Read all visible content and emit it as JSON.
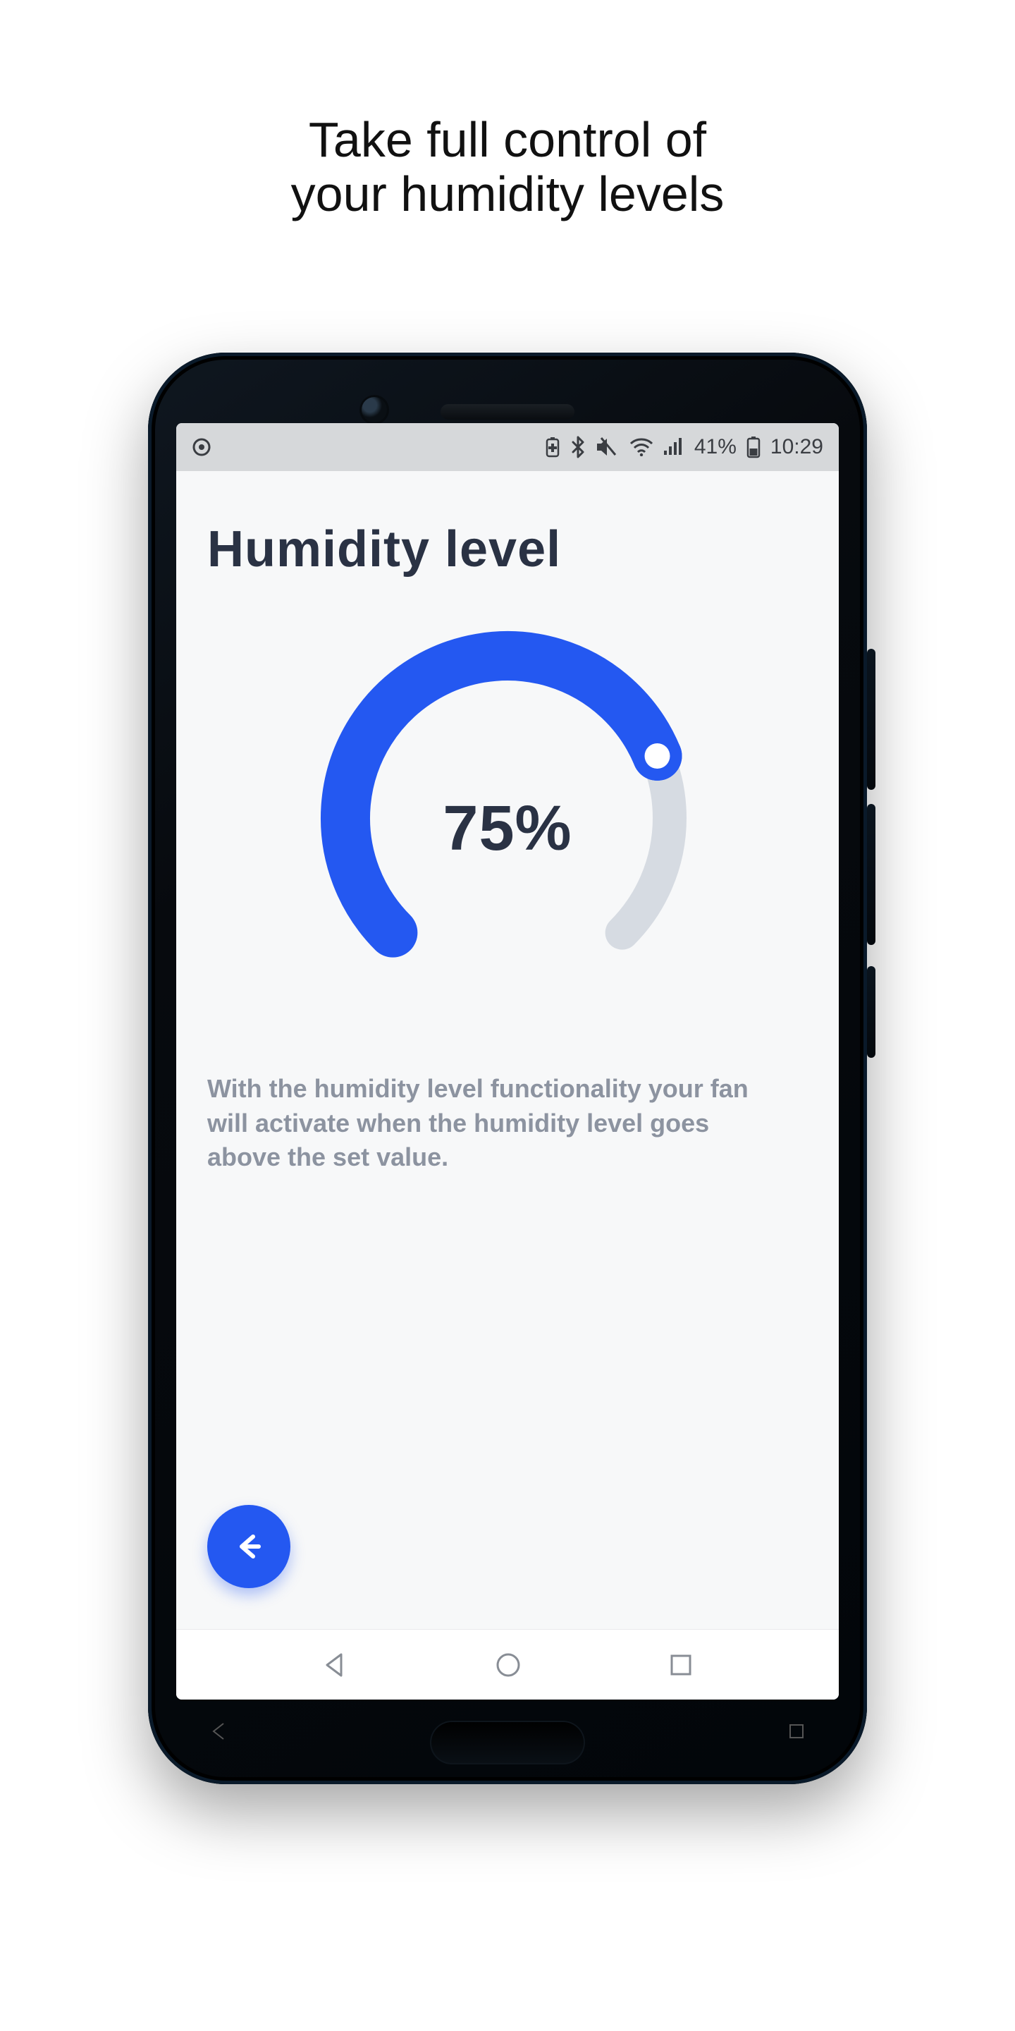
{
  "marketing": {
    "headline_line1": "Take full control of",
    "headline_line2": "your humidity levels"
  },
  "statusbar": {
    "carrier_icon": "carrier-circle-icon",
    "battery_saver_icon": "battery-saver-icon",
    "bluetooth_icon": "bluetooth-icon",
    "mute_icon": "volume-mute-icon",
    "wifi_icon": "wifi-icon",
    "signal_icon": "signal-icon",
    "battery_text": "41%",
    "battery_icon": "battery-icon",
    "clock": "10:29"
  },
  "app": {
    "title": "Humidity level",
    "gauge": {
      "value_text": "75%",
      "value_percent": 75,
      "track_color": "#d6dbe2",
      "fill_color": "#2458f1",
      "knob_color": "#ffffff"
    },
    "description": "With the humidity level functionality your fan will activate when the humidity level goes above the set value.",
    "back_button_icon": "arrow-left-icon"
  },
  "navbar": {
    "back_icon": "nav-back-icon",
    "home_icon": "nav-home-icon",
    "recent_icon": "nav-recent-icon"
  },
  "chart_data": {
    "type": "gauge",
    "title": "Humidity level",
    "value": 75,
    "unit": "%",
    "range": [
      0,
      100
    ],
    "start_angle_deg": 135,
    "sweep_deg": 270
  }
}
